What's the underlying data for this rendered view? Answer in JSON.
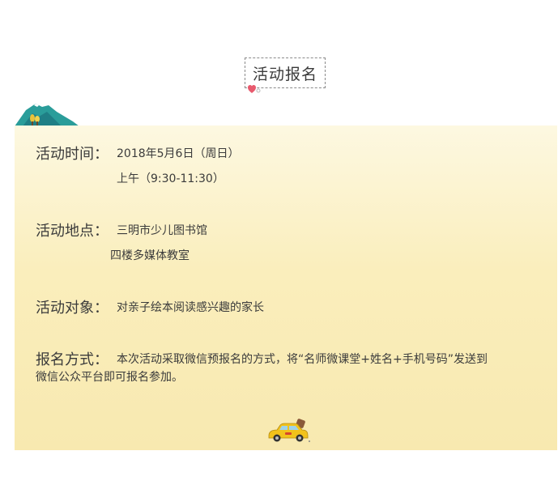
{
  "header": {
    "title": "活动报名"
  },
  "info": {
    "time": {
      "label": "活动时间：",
      "line1": "2018年5月6日（周日）",
      "line2": "上午（9:30-11:30）"
    },
    "place": {
      "label": "活动地点：",
      "line1": "三明市少儿图书馆",
      "line2": "四楼多媒体教室"
    },
    "audience": {
      "label": "活动对象：",
      "line1": "对亲子绘本阅读感兴趣的家长"
    },
    "method": {
      "label": "报名方式：",
      "line1": "本次活动采取微信预报名的方式，将“名师微课堂+姓名+手机号码”发送到",
      "line2": "微信公众平台即可报名参加。"
    }
  },
  "colors": {
    "card_top": "#fdf8e1",
    "card_bottom": "#f8e9b0",
    "mountain": "#2a9d9a",
    "heart": "#e85a6e",
    "taxi": "#f2c21b"
  },
  "icons": [
    "heart-icon",
    "mountain-icon",
    "taxi-icon"
  ]
}
